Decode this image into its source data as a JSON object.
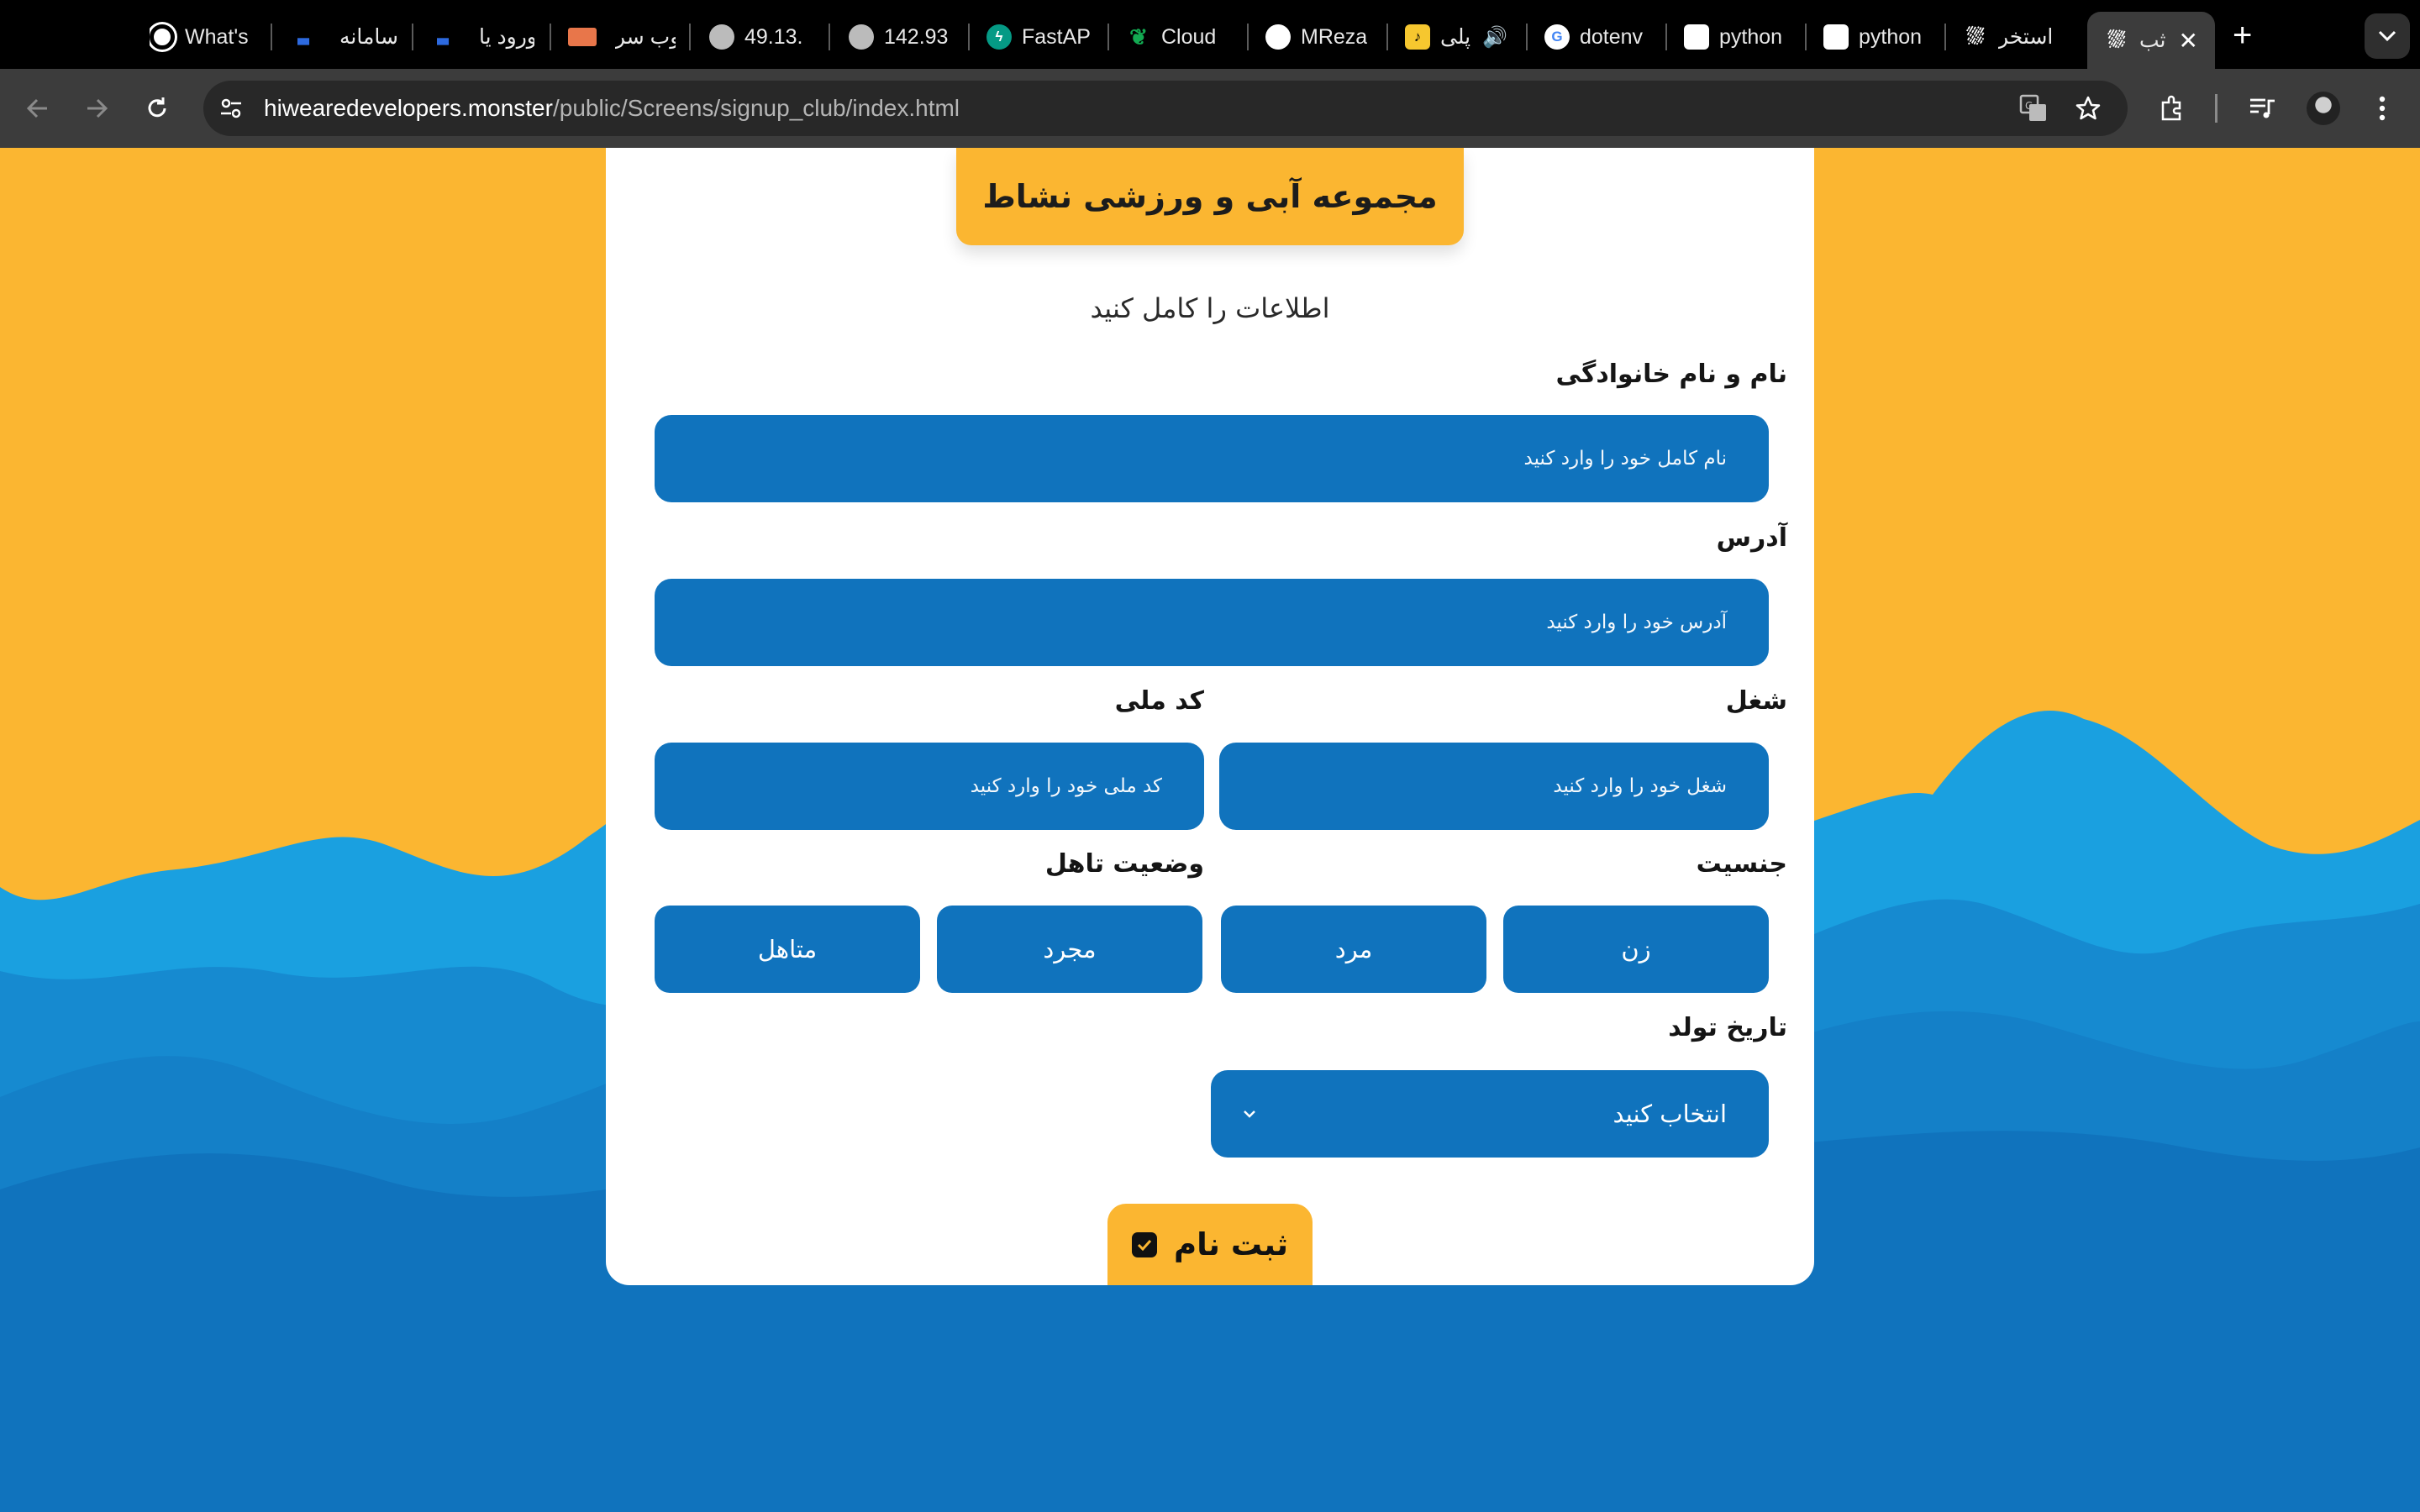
{
  "browser": {
    "tabs": [
      {
        "title": "What's",
        "icon": "chrome-icon"
      },
      {
        "title": "سامانه",
        "icon": "site-icon"
      },
      {
        "title": "ورود یا",
        "icon": "site-icon"
      },
      {
        "title": "وب سر",
        "icon": "site-icon"
      },
      {
        "title": "49.13.",
        "icon": "globe-icon"
      },
      {
        "title": "142.93",
        "icon": "globe-icon"
      },
      {
        "title": "FastAP",
        "icon": "fastapi-icon"
      },
      {
        "title": "Cloud",
        "icon": "mongodb-icon"
      },
      {
        "title": "MReza",
        "icon": "github-icon"
      },
      {
        "title": "پلی",
        "icon": "music-icon"
      },
      {
        "title": "dotenv",
        "icon": "google-icon"
      },
      {
        "title": "python",
        "icon": "cube-icon"
      },
      {
        "title": "python",
        "icon": "cube-icon"
      },
      {
        "title": "استخر",
        "icon": "pool-icon"
      },
      {
        "title": "ثب",
        "icon": "pool-icon",
        "active": true
      }
    ],
    "url_host": "hiwearedevelopers.monster",
    "url_path": "/public/Screens/signup_club/index.html"
  },
  "form": {
    "title": "مجموعه آبی و ورزشی نشاط",
    "subtitle": "اطلاعات را کامل کنید",
    "fullname": {
      "label": "نام و نام خانوادگی",
      "placeholder": "نام کامل خود را وارد کنید"
    },
    "address": {
      "label": "آدرس",
      "placeholder": "آدرس خود را وارد کنید"
    },
    "job": {
      "label": "شغل",
      "placeholder": "شغل خود را وارد کنید"
    },
    "national_code": {
      "label": "کد ملی",
      "placeholder": "کد ملی خود را وارد کنید"
    },
    "gender": {
      "label": "جنسیت",
      "options": [
        "زن",
        "مرد"
      ]
    },
    "marital": {
      "label": "وضعیت تاهل",
      "options": [
        "مجرد",
        "متاهل"
      ]
    },
    "birthdate": {
      "label": "تاریخ تولد",
      "selected": "انتخاب کنید"
    },
    "submit_label": "ثبت نام"
  },
  "colors": {
    "background": "#fbb631",
    "field": "#1073bd",
    "wave_light": "#1aa0e0",
    "wave_mid": "#168ad0",
    "wave_dark": "#1073bd",
    "accent": "#fbb631"
  }
}
